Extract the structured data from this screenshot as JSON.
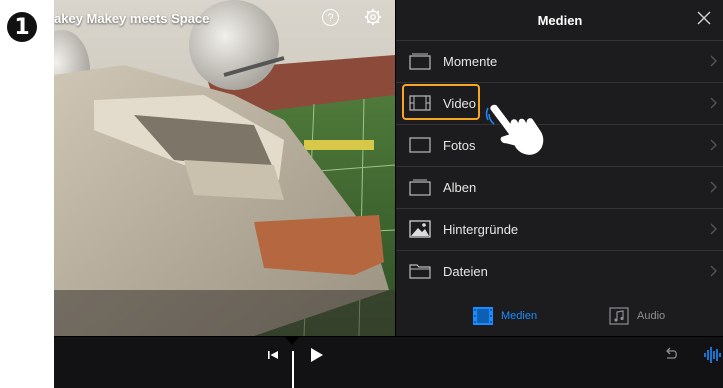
{
  "step": {
    "number": "1"
  },
  "preview": {
    "project_title": "akey Makey meets Space",
    "help_icon_text": "?"
  },
  "panel": {
    "title": "Medien",
    "items": [
      {
        "label": "Momente",
        "icon": "moments-icon"
      },
      {
        "label": "Video",
        "icon": "film-icon"
      },
      {
        "label": "Fotos",
        "icon": "photo-frame-icon"
      },
      {
        "label": "Alben",
        "icon": "albums-icon"
      },
      {
        "label": "Hintergründe",
        "icon": "backgrounds-icon"
      },
      {
        "label": "Dateien",
        "icon": "folder-icon"
      }
    ],
    "tabs": {
      "media_label": "Medien",
      "audio_label": "Audio"
    }
  },
  "colors": {
    "accent": "#1a8cff",
    "highlight": "#f5a623",
    "panel_bg": "#1c1c1e"
  }
}
